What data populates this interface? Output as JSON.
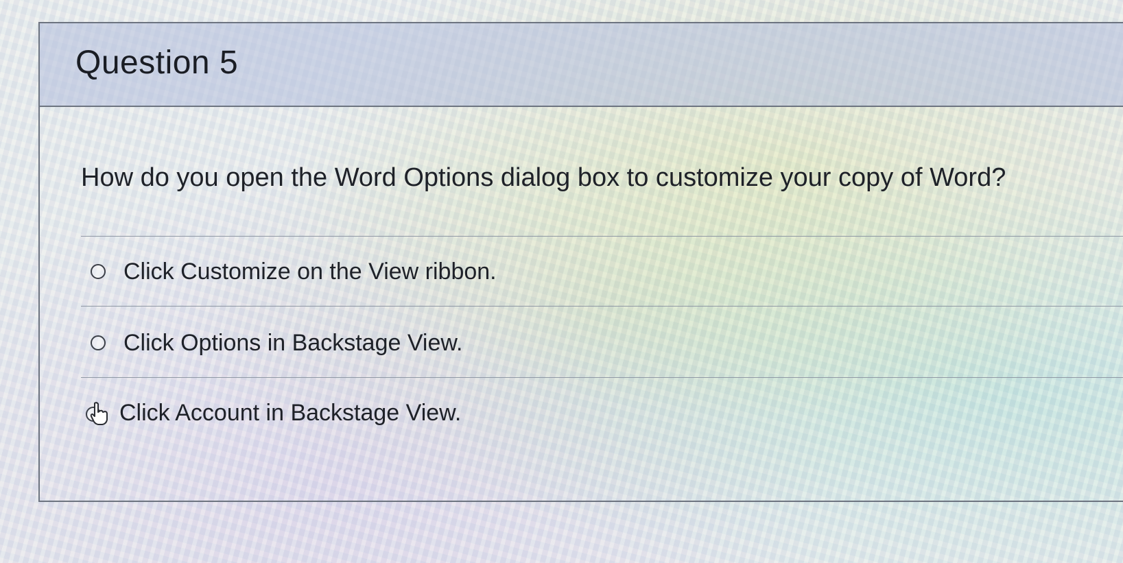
{
  "question": {
    "title": "Question 5",
    "prompt": "How do you open the Word Options dialog box to customize your copy of Word?",
    "answers": [
      {
        "label": "Click Customize on the View ribbon."
      },
      {
        "label": "Click Options in Backstage View."
      },
      {
        "label": "Click Account in Backstage View."
      }
    ]
  },
  "icons": {
    "expand": "chevron-right-icon",
    "radio": "radio-button-icon",
    "pointer": "hand-pointer-cursor-icon"
  },
  "colors": {
    "header_background": "#b2bedc",
    "border": "#6d7480",
    "text": "#1e2128"
  }
}
